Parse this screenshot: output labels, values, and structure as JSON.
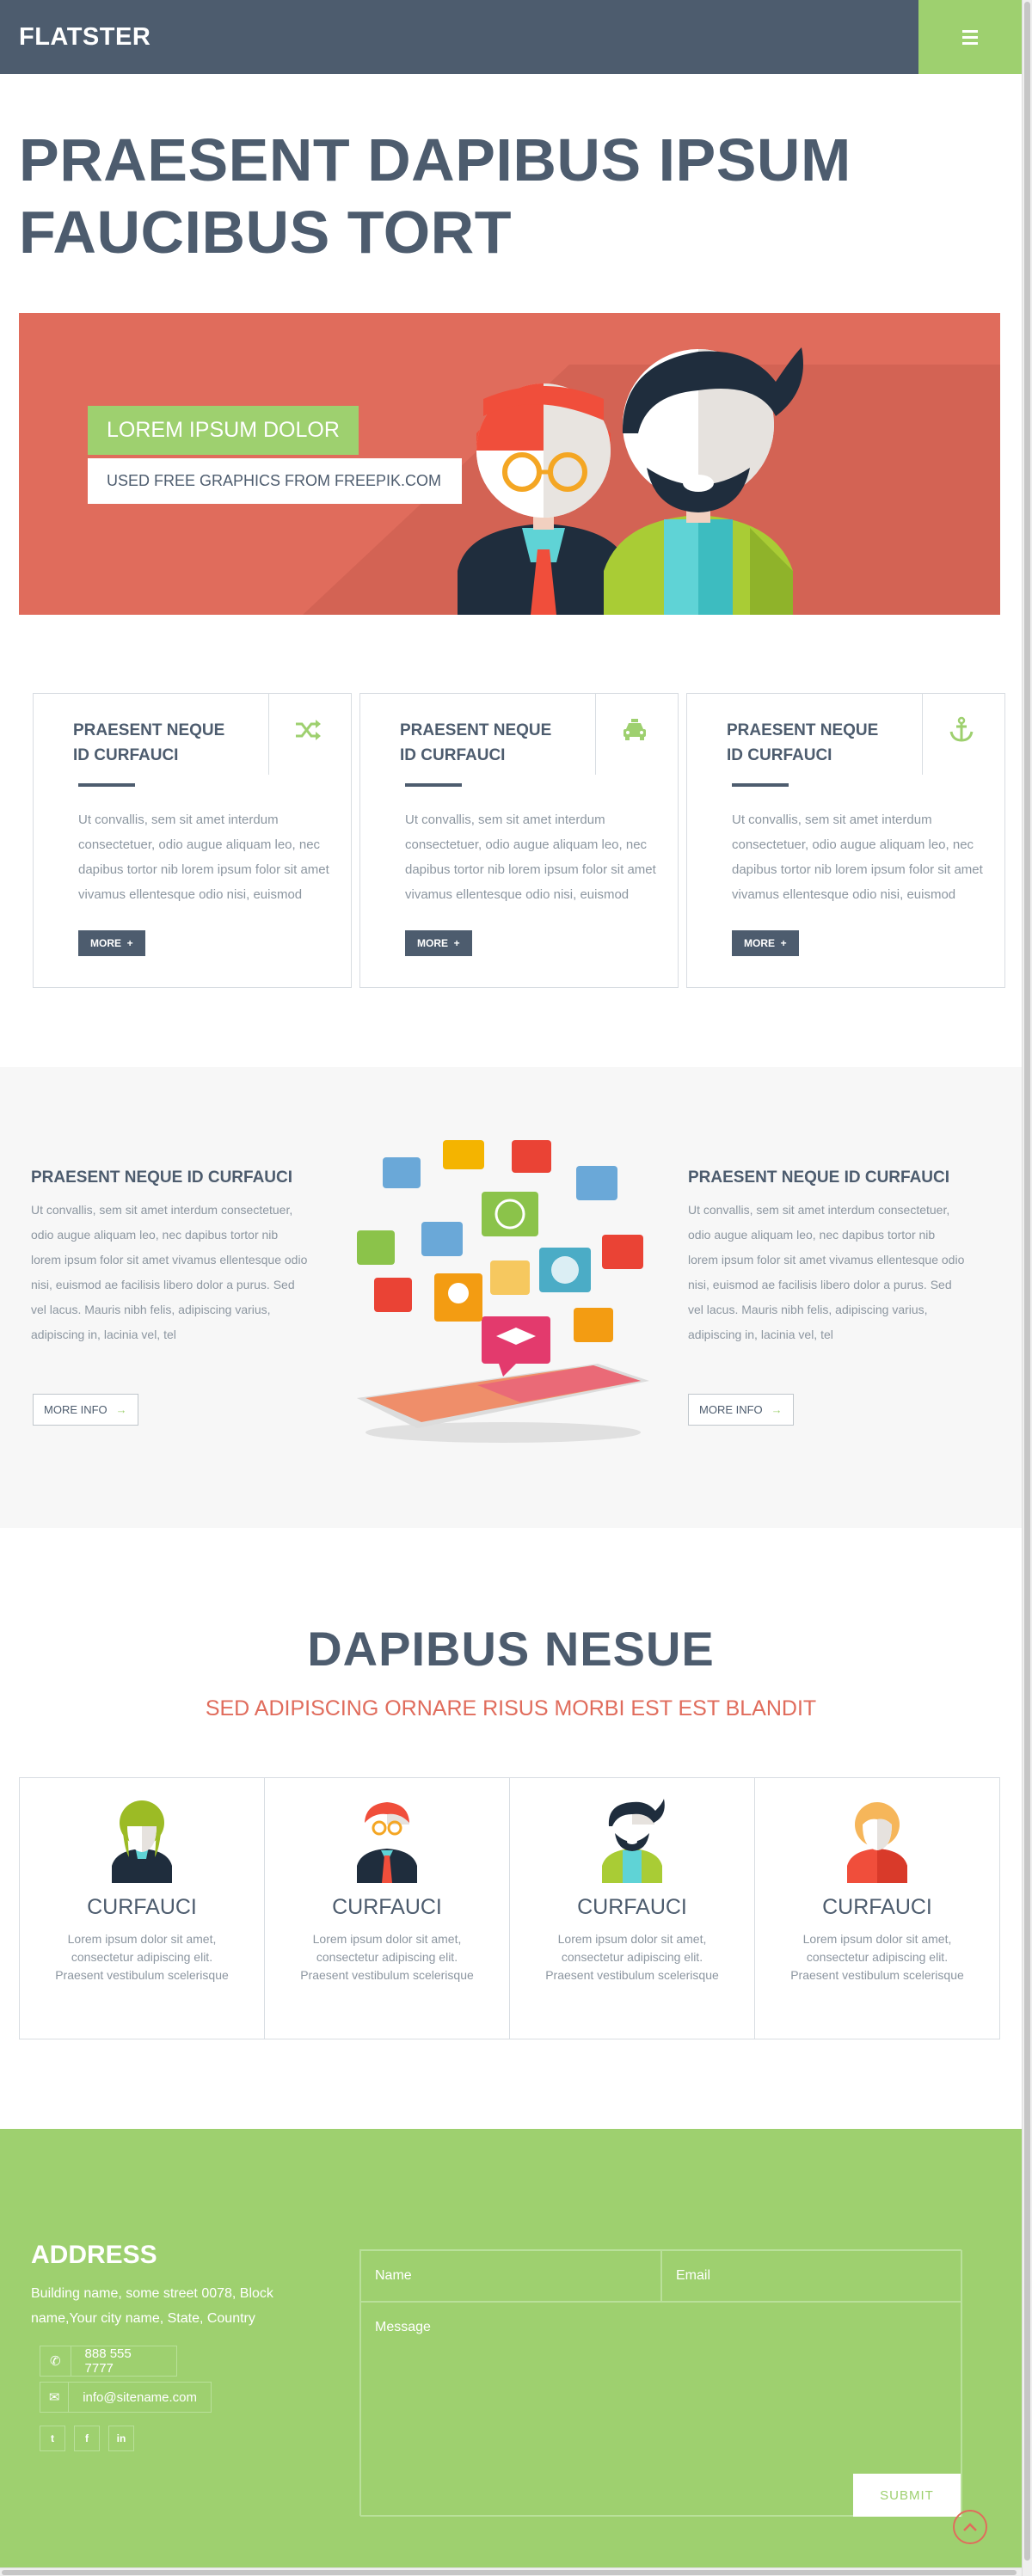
{
  "header": {
    "brand": "FLATSTER",
    "menu_icon": "hamburger-icon"
  },
  "hero": {
    "title_line1": "PRAESENT DAPIBUS IPSUM",
    "title_line2": "FAUCIBUS TORT"
  },
  "banner": {
    "tag1": "LOREM IPSUM DOLOR",
    "tag2": "USED FREE GRAPHICS FROM FREEPIK.COM"
  },
  "features": [
    {
      "title_line1": "PRAESENT NEQUE",
      "title_line2": "ID CURFAUCI",
      "icon": "shuffle-icon",
      "text": "Ut convallis, sem sit amet interdum consectetuer, odio augue aliquam leo, nec dapibus tortor nib lorem ipsum folor sit amet vivamus ellentesque odio nisi, euismod",
      "button": "MORE"
    },
    {
      "title_line1": "PRAESENT NEQUE",
      "title_line2": "ID CURFAUCI",
      "icon": "taxi-icon",
      "text": "Ut convallis, sem sit amet interdum consectetuer, odio augue aliquam leo, nec dapibus tortor nib lorem ipsum folor sit amet vivamus ellentesque odio nisi, euismod",
      "button": "MORE"
    },
    {
      "title_line1": "PRAESENT NEQUE",
      "title_line2": "ID CURFAUCI",
      "icon": "anchor-icon",
      "text": "Ut convallis, sem sit amet interdum consectetuer, odio augue aliquam leo, nec dapibus tortor nib lorem ipsum folor sit amet vivamus ellentesque odio nisi, euismod",
      "button": "MORE"
    }
  ],
  "info": {
    "left": {
      "title": "PRAESENT NEQUE ID CURFAUCI",
      "text": "Ut convallis, sem sit amet interdum consectetuer, odio augue aliquam leo, nec dapibus tortor nib lorem ipsum folor sit amet vivamus ellentesque odio nisi, euismod ae facilisis libero dolor a purus. Sed vel lacus. Mauris nibh felis, adipiscing varius, adipiscing in, lacinia vel, tel",
      "button": "MORE INFO"
    },
    "right": {
      "title": "PRAESENT NEQUE ID CURFAUCI",
      "text": "Ut convallis, sem sit amet interdum consectetuer, odio augue aliquam leo, nec dapibus tortor nib lorem ipsum folor sit amet vivamus ellentesque odio nisi, euismod ae facilisis libero dolor a purus. Sed vel lacus. Mauris nibh felis, adipiscing varius, adipiscing in, lacinia vel, tel",
      "button": "MORE INFO"
    }
  },
  "team_section": {
    "title": "DAPIBUS NESUE",
    "subtitle": "SED ADIPISCING ORNARE RISUS MORBI EST EST BLANDIT",
    "members": [
      {
        "name": "CURFAUCI",
        "text": "Lorem ipsum dolor sit amet, consectetur adipiscing elit. Praesent vestibulum scelerisque"
      },
      {
        "name": "CURFAUCI",
        "text": "Lorem ipsum dolor sit amet, consectetur adipiscing elit. Praesent vestibulum scelerisque"
      },
      {
        "name": "CURFAUCI",
        "text": "Lorem ipsum dolor sit amet, consectetur adipiscing elit. Praesent vestibulum scelerisque"
      },
      {
        "name": "CURFAUCI",
        "text": "Lorem ipsum dolor sit amet, consectetur adipiscing elit. Praesent vestibulum scelerisque"
      }
    ]
  },
  "footer": {
    "address_title": "ADDRESS",
    "address_text": "Building name, some street 0078, Block name,Your city name, State, Country",
    "phone": "888 555 7777",
    "email": "info@sitename.com",
    "social": [
      "t",
      "f",
      "in"
    ],
    "form": {
      "name_placeholder": "Name",
      "email_placeholder": "Email",
      "message_placeholder": "Message",
      "submit": "SUBMIT"
    }
  },
  "colors": {
    "dark": "#4d5c6e",
    "green": "#9ed06f",
    "coral": "#e06c5c",
    "gray_bg": "#f7f7f7"
  }
}
